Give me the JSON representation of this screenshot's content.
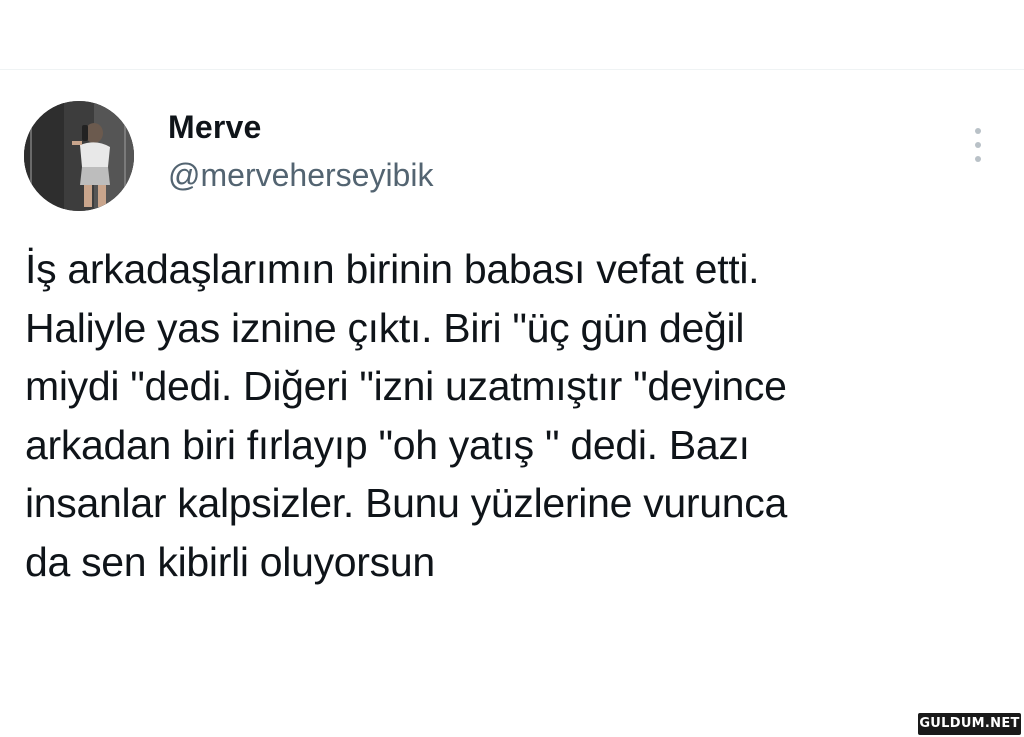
{
  "tweet": {
    "author": {
      "display_name": "Merve",
      "handle": "@merveherseyibik"
    },
    "text": "İş arkadaşlarımın birinin babası vefat etti.\nHaliyle yas iznine çıktı. Biri \"üç gün değil\nmiydi \"dedi. Diğeri \"izni uzatmıştır \"deyince\narkadan biri fırlayıp \"oh yatış \" dedi. Bazı\ninsanlar kalpsizler. Bunu yüzlerine vurunca\nda sen kibirli oluyorsun",
    "more_icon": "more-vertical-icon"
  },
  "watermark": {
    "text": "GULDUM.NET"
  },
  "colors": {
    "text_primary": "#0f1419",
    "text_secondary": "#536471",
    "divider": "#eff3f4",
    "background": "#ffffff"
  }
}
